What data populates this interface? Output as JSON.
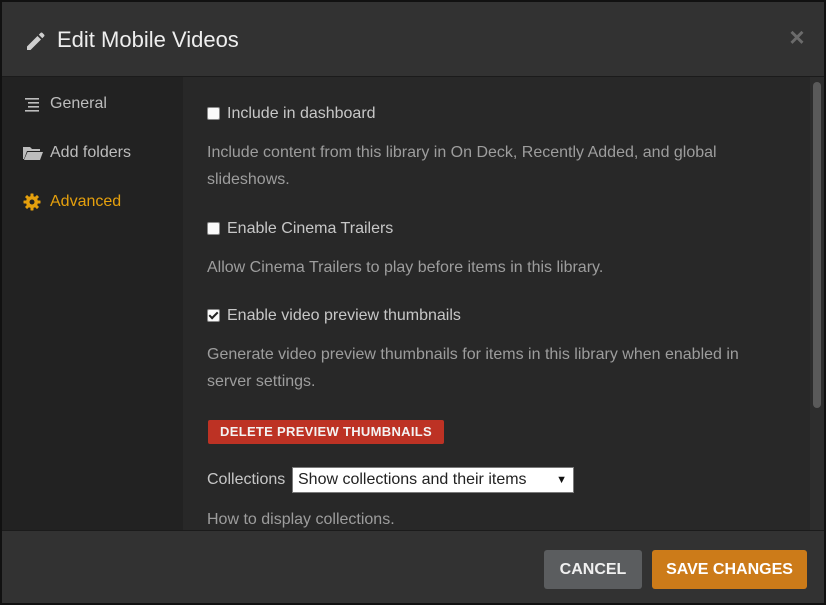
{
  "dialog": {
    "title": "Edit Mobile Videos",
    "close_symbol": "×"
  },
  "sidebar": {
    "items": [
      {
        "label": "General",
        "icon": "list-icon",
        "active": false
      },
      {
        "label": "Add folders",
        "icon": "folder-icon",
        "active": false
      },
      {
        "label": "Advanced",
        "icon": "gear-icon",
        "active": true
      }
    ]
  },
  "options": [
    {
      "label": "Include in dashboard",
      "checked": false,
      "description": "Include content from this library in On Deck, Recently Added, and global slideshows."
    },
    {
      "label": "Enable Cinema Trailers",
      "checked": false,
      "description": "Allow Cinema Trailers to play before items in this library."
    },
    {
      "label": "Enable video preview thumbnails",
      "checked": true,
      "description": "Generate video preview thumbnails for items in this library when enabled in server settings."
    }
  ],
  "delete_thumbnails_label": "DELETE PREVIEW THUMBNAILS",
  "collections": {
    "label": "Collections",
    "selected": "Show collections and their items",
    "description": "How to display collections."
  },
  "footer": {
    "cancel_label": "CANCEL",
    "save_label": "SAVE CHANGES"
  },
  "colors": {
    "accent": "#e5a00d",
    "danger": "#bd3224",
    "save": "#cc7b19",
    "cancel": "#5b5d5f"
  }
}
